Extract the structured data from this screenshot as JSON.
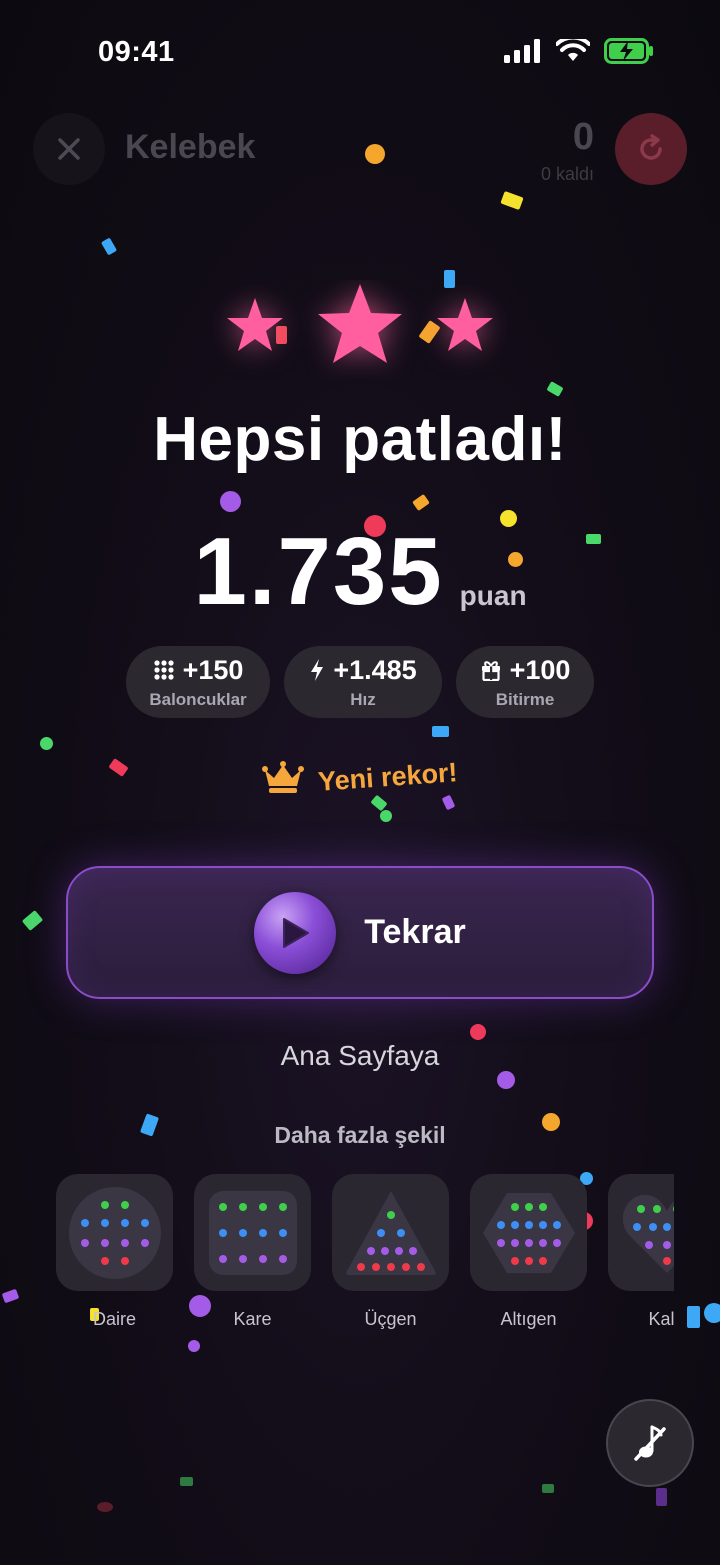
{
  "status": {
    "time": "09:41"
  },
  "header": {
    "level_title": "Kelebek",
    "remaining_count": "0",
    "remaining_label": "0 kaldı"
  },
  "result": {
    "stars_earned": 3,
    "headline": "Hepsi patladı!",
    "score": "1.735",
    "score_unit": "puan"
  },
  "bonuses": [
    {
      "icon": "grid-icon",
      "value": "+150",
      "label": "Baloncuklar"
    },
    {
      "icon": "bolt-icon",
      "value": "+1.485",
      "label": "Hız"
    },
    {
      "icon": "gift-icon",
      "value": "+100",
      "label": "Bitirme"
    }
  ],
  "record": {
    "icon": "crown-icon",
    "text": "Yeni rekor!"
  },
  "actions": {
    "replay_label": "Tekrar",
    "home_label": "Ana Sayfaya"
  },
  "more_shapes": {
    "title": "Daha fazla şekil",
    "items": [
      {
        "label": "Daire"
      },
      {
        "label": "Kare"
      },
      {
        "label": "Üçgen"
      },
      {
        "label": "Altıgen"
      },
      {
        "label": "Kalp"
      }
    ]
  },
  "colors": {
    "star": "#ff5f9e",
    "accent_purple": "#8a4cc8",
    "record_gold": "#f5a63c",
    "restart_red": "#5a1e2a"
  }
}
